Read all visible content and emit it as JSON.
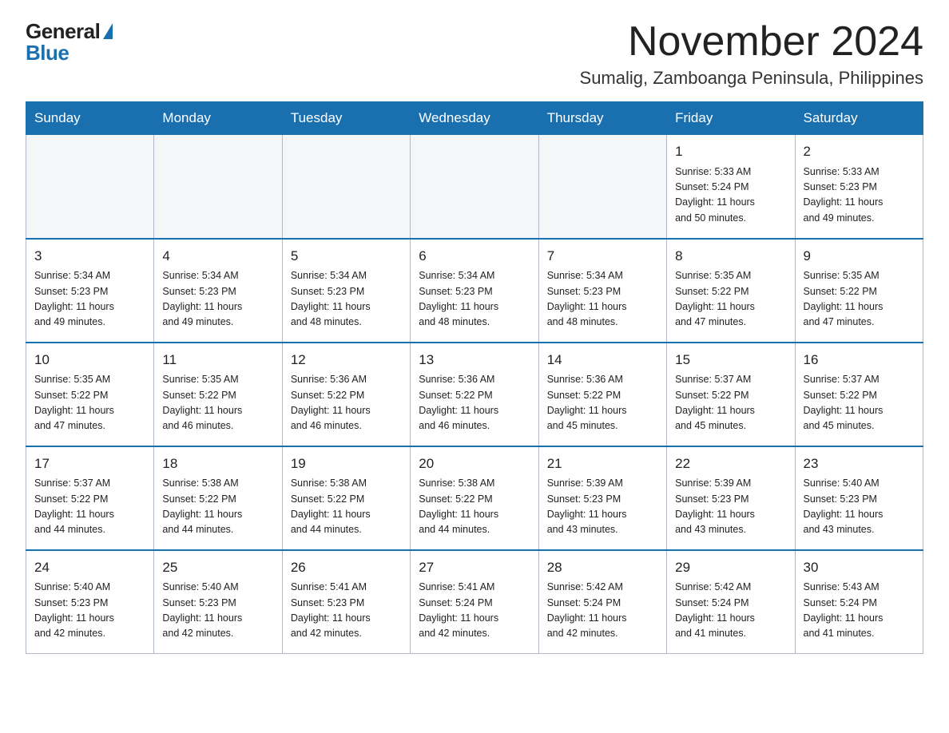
{
  "logo": {
    "general": "General",
    "blue": "Blue"
  },
  "title": "November 2024",
  "location": "Sumalig, Zamboanga Peninsula, Philippines",
  "weekdays": [
    "Sunday",
    "Monday",
    "Tuesday",
    "Wednesday",
    "Thursday",
    "Friday",
    "Saturday"
  ],
  "weeks": [
    [
      {
        "day": "",
        "info": ""
      },
      {
        "day": "",
        "info": ""
      },
      {
        "day": "",
        "info": ""
      },
      {
        "day": "",
        "info": ""
      },
      {
        "day": "",
        "info": ""
      },
      {
        "day": "1",
        "info": "Sunrise: 5:33 AM\nSunset: 5:24 PM\nDaylight: 11 hours\nand 50 minutes."
      },
      {
        "day": "2",
        "info": "Sunrise: 5:33 AM\nSunset: 5:23 PM\nDaylight: 11 hours\nand 49 minutes."
      }
    ],
    [
      {
        "day": "3",
        "info": "Sunrise: 5:34 AM\nSunset: 5:23 PM\nDaylight: 11 hours\nand 49 minutes."
      },
      {
        "day": "4",
        "info": "Sunrise: 5:34 AM\nSunset: 5:23 PM\nDaylight: 11 hours\nand 49 minutes."
      },
      {
        "day": "5",
        "info": "Sunrise: 5:34 AM\nSunset: 5:23 PM\nDaylight: 11 hours\nand 48 minutes."
      },
      {
        "day": "6",
        "info": "Sunrise: 5:34 AM\nSunset: 5:23 PM\nDaylight: 11 hours\nand 48 minutes."
      },
      {
        "day": "7",
        "info": "Sunrise: 5:34 AM\nSunset: 5:23 PM\nDaylight: 11 hours\nand 48 minutes."
      },
      {
        "day": "8",
        "info": "Sunrise: 5:35 AM\nSunset: 5:22 PM\nDaylight: 11 hours\nand 47 minutes."
      },
      {
        "day": "9",
        "info": "Sunrise: 5:35 AM\nSunset: 5:22 PM\nDaylight: 11 hours\nand 47 minutes."
      }
    ],
    [
      {
        "day": "10",
        "info": "Sunrise: 5:35 AM\nSunset: 5:22 PM\nDaylight: 11 hours\nand 47 minutes."
      },
      {
        "day": "11",
        "info": "Sunrise: 5:35 AM\nSunset: 5:22 PM\nDaylight: 11 hours\nand 46 minutes."
      },
      {
        "day": "12",
        "info": "Sunrise: 5:36 AM\nSunset: 5:22 PM\nDaylight: 11 hours\nand 46 minutes."
      },
      {
        "day": "13",
        "info": "Sunrise: 5:36 AM\nSunset: 5:22 PM\nDaylight: 11 hours\nand 46 minutes."
      },
      {
        "day": "14",
        "info": "Sunrise: 5:36 AM\nSunset: 5:22 PM\nDaylight: 11 hours\nand 45 minutes."
      },
      {
        "day": "15",
        "info": "Sunrise: 5:37 AM\nSunset: 5:22 PM\nDaylight: 11 hours\nand 45 minutes."
      },
      {
        "day": "16",
        "info": "Sunrise: 5:37 AM\nSunset: 5:22 PM\nDaylight: 11 hours\nand 45 minutes."
      }
    ],
    [
      {
        "day": "17",
        "info": "Sunrise: 5:37 AM\nSunset: 5:22 PM\nDaylight: 11 hours\nand 44 minutes."
      },
      {
        "day": "18",
        "info": "Sunrise: 5:38 AM\nSunset: 5:22 PM\nDaylight: 11 hours\nand 44 minutes."
      },
      {
        "day": "19",
        "info": "Sunrise: 5:38 AM\nSunset: 5:22 PM\nDaylight: 11 hours\nand 44 minutes."
      },
      {
        "day": "20",
        "info": "Sunrise: 5:38 AM\nSunset: 5:22 PM\nDaylight: 11 hours\nand 44 minutes."
      },
      {
        "day": "21",
        "info": "Sunrise: 5:39 AM\nSunset: 5:23 PM\nDaylight: 11 hours\nand 43 minutes."
      },
      {
        "day": "22",
        "info": "Sunrise: 5:39 AM\nSunset: 5:23 PM\nDaylight: 11 hours\nand 43 minutes."
      },
      {
        "day": "23",
        "info": "Sunrise: 5:40 AM\nSunset: 5:23 PM\nDaylight: 11 hours\nand 43 minutes."
      }
    ],
    [
      {
        "day": "24",
        "info": "Sunrise: 5:40 AM\nSunset: 5:23 PM\nDaylight: 11 hours\nand 42 minutes."
      },
      {
        "day": "25",
        "info": "Sunrise: 5:40 AM\nSunset: 5:23 PM\nDaylight: 11 hours\nand 42 minutes."
      },
      {
        "day": "26",
        "info": "Sunrise: 5:41 AM\nSunset: 5:23 PM\nDaylight: 11 hours\nand 42 minutes."
      },
      {
        "day": "27",
        "info": "Sunrise: 5:41 AM\nSunset: 5:24 PM\nDaylight: 11 hours\nand 42 minutes."
      },
      {
        "day": "28",
        "info": "Sunrise: 5:42 AM\nSunset: 5:24 PM\nDaylight: 11 hours\nand 42 minutes."
      },
      {
        "day": "29",
        "info": "Sunrise: 5:42 AM\nSunset: 5:24 PM\nDaylight: 11 hours\nand 41 minutes."
      },
      {
        "day": "30",
        "info": "Sunrise: 5:43 AM\nSunset: 5:24 PM\nDaylight: 11 hours\nand 41 minutes."
      }
    ]
  ]
}
